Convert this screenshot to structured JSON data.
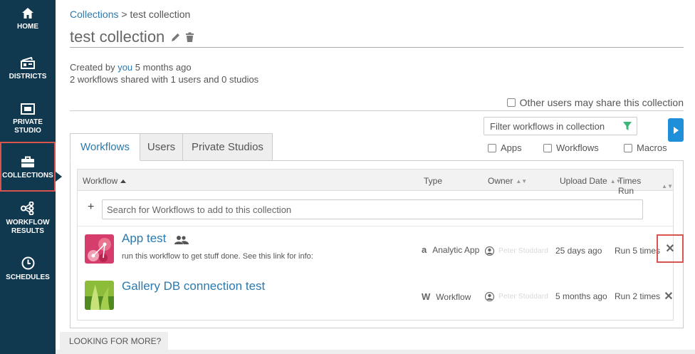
{
  "sidebar": {
    "items": [
      {
        "label": "HOME",
        "icon": "home-icon"
      },
      {
        "label": "DISTRICTS",
        "icon": "districts-icon"
      },
      {
        "label": "PRIVATE STUDIO",
        "icon": "private-studio-icon"
      },
      {
        "label": "COLLECTIONS",
        "icon": "briefcase-icon",
        "active": true
      },
      {
        "label": "WORKFLOW RESULTS",
        "icon": "workflow-results-icon"
      },
      {
        "label": "SCHEDULES",
        "icon": "clock-icon"
      }
    ]
  },
  "breadcrumb": {
    "parent": "Collections",
    "separator": " > ",
    "current": "test collection"
  },
  "page": {
    "title": "test collection"
  },
  "meta": {
    "created_prefix": "Created by ",
    "created_user": "you",
    "created_suffix": " 5 months ago",
    "shared_summary": "2 workflows shared with 1 users and 0 studios"
  },
  "share_option": {
    "label": "Other users may share this collection",
    "checked": false
  },
  "tabs": [
    {
      "label": "Workflows",
      "active": true
    },
    {
      "label": "Users",
      "active": false
    },
    {
      "label": "Private Studios",
      "active": false
    }
  ],
  "filter": {
    "placeholder": "Filter workflows in collection",
    "types": [
      {
        "label": "Apps",
        "checked": false
      },
      {
        "label": "Workflows",
        "checked": false
      },
      {
        "label": "Macros",
        "checked": false
      }
    ]
  },
  "table": {
    "columns": {
      "workflow": "Workflow",
      "type": "Type",
      "owner": "Owner",
      "upload_date": "Upload Date",
      "times_run": "Times Run"
    },
    "search_placeholder": "Search for Workflows to add to this collection",
    "rows": [
      {
        "name": "App test",
        "description": "run this workflow to get stuff done. See this link for info:",
        "type_glyph": "a",
        "type": "Analytic App",
        "owner": "Peter Stoddard",
        "upload_date": "25 days ago",
        "times_run": "Run 5 times",
        "shared_icon": "users-icon"
      },
      {
        "name": "Gallery DB connection test",
        "description": "",
        "type_glyph": "W",
        "type": "Workflow",
        "owner": "Peter Stoddard",
        "upload_date": "5 months ago",
        "times_run": "Run 2 times"
      }
    ]
  },
  "footer": {
    "looking_for_more": "LOOKING FOR MORE?"
  },
  "colors": {
    "sidebar": "#10384f",
    "link": "#2a7ab0",
    "accent_button": "#1e8fd8",
    "highlight": "#d9534f",
    "funnel": "#3cb77a"
  }
}
